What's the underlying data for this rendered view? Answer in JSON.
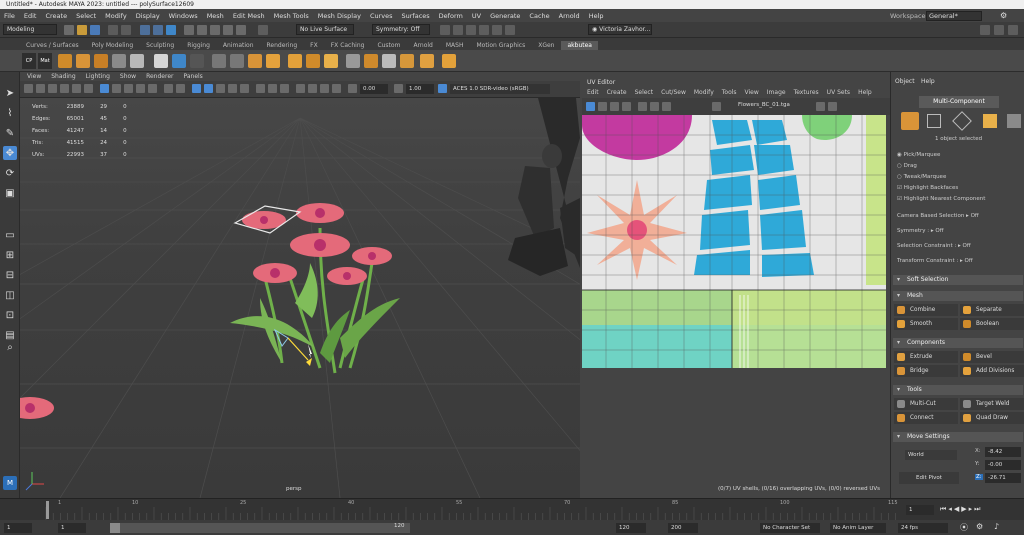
{
  "window": {
    "title": "Untitled* - Autodesk MAYA 2023: untitled  ---  polySurface12609"
  },
  "menubar": {
    "items": [
      "File",
      "Edit",
      "Create",
      "Select",
      "Modify",
      "Display",
      "Windows",
      "Mesh",
      "Edit Mesh",
      "Mesh Tools",
      "Mesh Display",
      "Curves",
      "Surfaces",
      "Deform",
      "UV",
      "Generate",
      "Cache",
      "Arnold",
      "Help"
    ],
    "workspace_label": "Workspace:",
    "workspace_value": "General*"
  },
  "statusline": {
    "mode": "Modeling",
    "live_surface": "No Live Surface",
    "symmetry": "Symmetry: Off",
    "user": "Victoria Zavhor..."
  },
  "shelf": {
    "tabs": [
      "Curves / Surfaces",
      "Poly Modeling",
      "Sculpting",
      "Rigging",
      "Animation",
      "Rendering",
      "FX",
      "FX Caching",
      "Custom",
      "Arnold",
      "MASH",
      "Motion Graphics",
      "XGen",
      "akbutea"
    ],
    "active_tab": "akbutea",
    "cp_label": "CP",
    "mat_label": "Mat"
  },
  "viewport": {
    "menu": [
      "View",
      "Shading",
      "Lighting",
      "Show",
      "Renderer",
      "Panels"
    ],
    "gamma_value": "1.00",
    "exposure_value": "0.00",
    "colorspace": "ACES 1.0 SDR-video (sRGB)",
    "camera_label": "persp",
    "hud": [
      {
        "label": "Verts:",
        "a": "23889",
        "b": "29",
        "c": "0"
      },
      {
        "label": "Edges:",
        "a": "65001",
        "b": "45",
        "c": "0"
      },
      {
        "label": "Faces:",
        "a": "41247",
        "b": "14",
        "c": "0"
      },
      {
        "label": "Tris:",
        "a": "41515",
        "b": "24",
        "c": "0"
      },
      {
        "label": "UVs:",
        "a": "22993",
        "b": "37",
        "c": "0"
      }
    ]
  },
  "uv_editor": {
    "title": "UV Editor",
    "menu": [
      "Edit",
      "Create",
      "Select",
      "Cut/Sew",
      "Modify",
      "Tools",
      "View",
      "Image",
      "Textures",
      "UV Sets",
      "Help"
    ],
    "texture_name": "Flowers_BC_01.tga",
    "status": "(0/7) UV shells, (0/16) overlapping UVs, (0/0) reversed UVs"
  },
  "attr_panel": {
    "tabs": [
      "Object",
      "Help"
    ],
    "component_mode": "Multi-Component",
    "selected_count": "1 object selected",
    "pick_options": [
      "Pick/Marquee",
      "Drag",
      "Tweak/Marquee"
    ],
    "checks": [
      "Highlight Backfaces",
      "Highlight Nearest Component"
    ],
    "camera_selection": "Camera Based Selection",
    "camera_selection_value": "Off",
    "symmetry_label": "Symmetry :",
    "symmetry_value": "Off",
    "selection_constraint": "Selection Constraint :",
    "selection_constraint_value": "Off",
    "transform_constraint": "Transform Constraint :",
    "transform_constraint_value": "Off",
    "soft_selection": "Soft Selection",
    "sections": {
      "mesh": "Mesh",
      "components": "Components",
      "tools": "Tools",
      "move_settings": "Move Settings"
    },
    "mesh_buttons": [
      "Combine",
      "Separate",
      "Smooth",
      "Boolean"
    ],
    "component_buttons": [
      "Extrude",
      "Bevel",
      "Bridge",
      "Add Divisions"
    ],
    "tool_buttons": [
      "Multi-Cut",
      "Target Weld",
      "Connect",
      "Quad Draw"
    ],
    "move": {
      "space": "World",
      "edit_pivot": "Edit Pivot",
      "x_label": "X:",
      "x_value": "-8.42",
      "y_label": "Y:",
      "y_value": "-0.00",
      "z_label": "Z:",
      "z_value": "-26.71"
    }
  },
  "timeline": {
    "ticks": [
      "1",
      "5",
      "10",
      "15",
      "20",
      "25",
      "30",
      "35",
      "40",
      "45",
      "50",
      "55",
      "60",
      "65",
      "70",
      "75",
      "80",
      "85",
      "90",
      "95",
      "100",
      "105",
      "110",
      "115",
      "120"
    ],
    "current_frame": "1"
  },
  "rangebar": {
    "start": "1",
    "start2": "1",
    "slider_end": "120",
    "end1": "120",
    "end2": "200",
    "character_set": "No Character Set",
    "anim_layer": "No Anim Layer",
    "fps": "24 fps"
  },
  "colors": {
    "accent": "#4a8ad4",
    "mesh_orange": "#c8822a",
    "uv_pink": "#d63a8a",
    "uv_cyan": "#2fb2d8",
    "uv_green": "#7fd17a"
  }
}
